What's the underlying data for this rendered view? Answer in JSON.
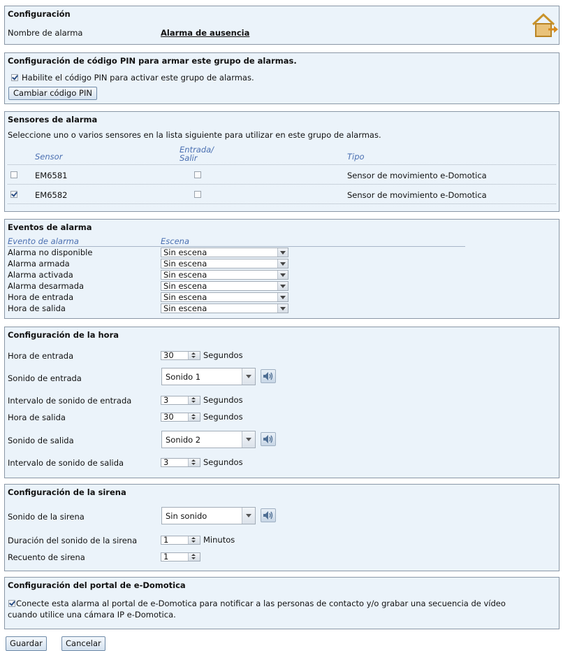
{
  "config": {
    "title": "Configuración",
    "alarm_name_label": "Nombre de alarma",
    "alarm_name_value": "Alarma de ausencia",
    "icon": "house-exit-icon"
  },
  "pin": {
    "title": "Configuración de código PIN para armar este grupo de alarmas.",
    "enable_label": "Habilite el código PIN para activar este grupo de alarmas.",
    "enable_checked": true,
    "change_button": "Cambiar código PIN"
  },
  "sensors": {
    "title": "Sensores de alarma",
    "description": "Seleccione uno o varios sensores en la lista siguiente para utilizar en este grupo de alarmas.",
    "headers": {
      "sensor": "Sensor",
      "entry_exit_line1": "Entrada/",
      "entry_exit_line2": "Salir",
      "type": "Tipo"
    },
    "rows": [
      {
        "name": "EM6581",
        "selected": false,
        "entry_exit": false,
        "type": "Sensor de movimiento e-Domotica"
      },
      {
        "name": "EM6582",
        "selected": true,
        "entry_exit": false,
        "type": "Sensor de movimiento e-Domotica"
      }
    ]
  },
  "events": {
    "title": "Eventos de alarma",
    "headers": {
      "event": "Evento de alarma",
      "scene": "Escena"
    },
    "rows": [
      {
        "event": "Alarma no disponible",
        "scene": "Sin escena"
      },
      {
        "event": "Alarma armada",
        "scene": "Sin escena"
      },
      {
        "event": "Alarma activada",
        "scene": "Sin escena"
      },
      {
        "event": "Alarma desarmada",
        "scene": "Sin escena"
      },
      {
        "event": "Hora de entrada",
        "scene": "Sin escena"
      },
      {
        "event": "Hora de salida",
        "scene": "Sin escena"
      }
    ]
  },
  "time": {
    "title": "Configuración de la hora",
    "entry_time_label": "Hora de entrada",
    "entry_time_value": "30",
    "entry_time_unit": "Segundos",
    "entry_sound_label": "Sonido de entrada",
    "entry_sound_value": "Sonido 1",
    "entry_interval_label": "Intervalo de sonido de entrada",
    "entry_interval_value": "3",
    "entry_interval_unit": "Segundos",
    "exit_time_label": "Hora de salida",
    "exit_time_value": "30",
    "exit_time_unit": "Segundos",
    "exit_sound_label": "Sonido de salida",
    "exit_sound_value": "Sonido 2",
    "exit_interval_label": "Intervalo de sonido de salida",
    "exit_interval_value": "3",
    "exit_interval_unit": "Segundos"
  },
  "siren": {
    "title": "Configuración de la sirena",
    "sound_label": "Sonido de la sirena",
    "sound_value": "Sin sonido",
    "duration_label": "Duración del sonido de la sirena",
    "duration_value": "1",
    "duration_unit": "Minutos",
    "count_label": "Recuento de sirena",
    "count_value": "1"
  },
  "portal": {
    "title": "Configuración del portal de e-Domotica",
    "connect_line1": "Conecte esta alarma al portal de e-Domotica para notificar a las personas de contacto y/o grabar una secuencia de vídeo",
    "connect_line2": "cuando utilice una cámara IP e-Domotica.",
    "connect_checked": true
  },
  "actions": {
    "save": "Guardar",
    "cancel": "Cancelar"
  },
  "colors": {
    "panel_bg": "#ebf3fa",
    "panel_border": "#8a97a6",
    "header_text": "#4a6fb1"
  }
}
